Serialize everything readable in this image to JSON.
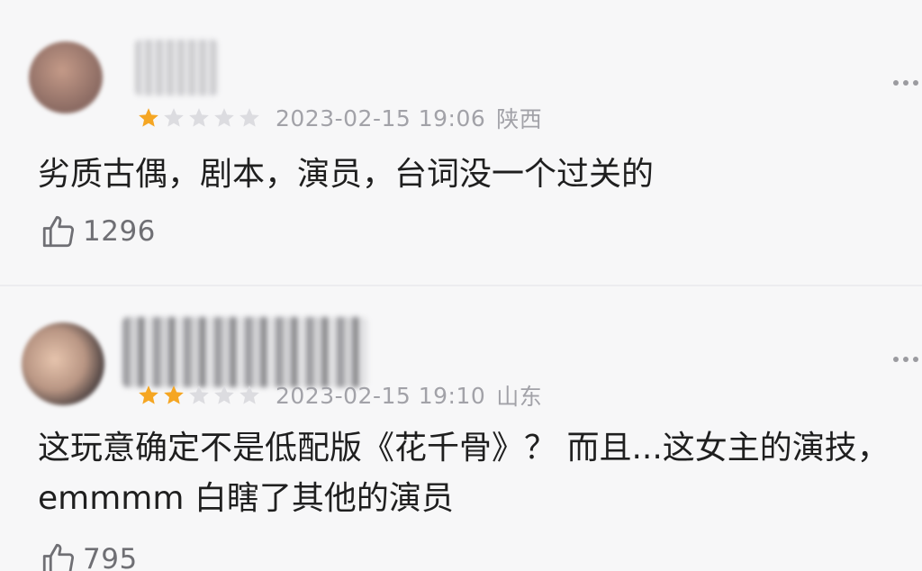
{
  "comments": [
    {
      "rating": 1,
      "date": "2023-02-15 19:06",
      "region": "陕西",
      "text": "劣质古偶，剧本，演员，台词没一个过关的",
      "likes": "1296"
    },
    {
      "rating": 2,
      "date": "2023-02-15 19:10",
      "region": "山东",
      "text": "这玩意确定不是低配版《花千骨》？ 而且...这女主的演技，emmmm 白瞎了其他的演员",
      "likes": "795"
    }
  ],
  "colors": {
    "star_filled": "#f5a623",
    "star_empty": "#dcdce0",
    "meta_text": "#a2a2a8",
    "body_text": "#1f1f1f"
  },
  "icons": {
    "like": "thumbs-up-icon",
    "more": "more-dots-icon",
    "star": "star-icon"
  }
}
